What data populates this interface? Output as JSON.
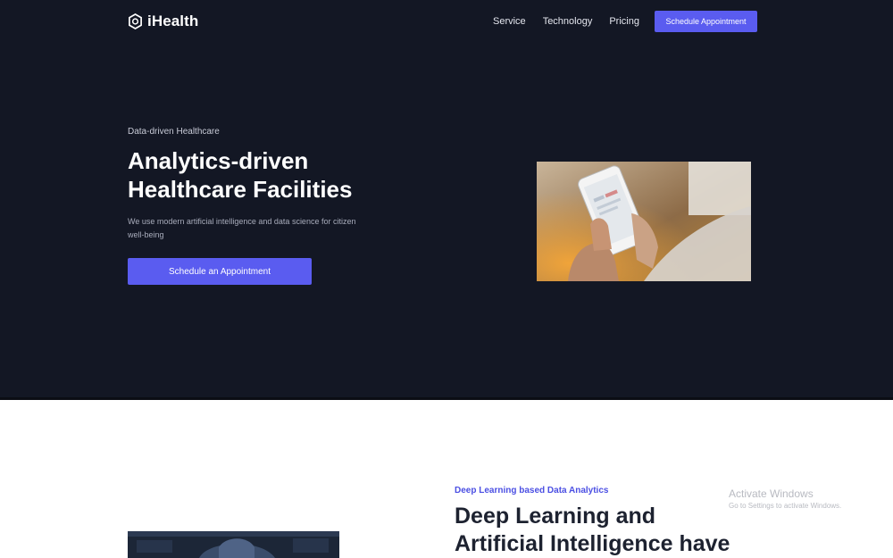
{
  "header": {
    "logo_text": "iHealth",
    "nav": [
      "Service",
      "Technology",
      "Pricing"
    ],
    "cta": "Schedule Appointment"
  },
  "hero": {
    "eyebrow": "Data-driven Healthcare",
    "title": "Analytics-driven Healthcare Facilities",
    "subtitle": "We use modern artificial intelligence and data science for citizen well-being",
    "button": "Schedule an Appointment"
  },
  "section": {
    "eyebrow": "Deep Learning based Data Analytics",
    "title": "Deep Learning and Artificial Intelligence have"
  },
  "overlay": {
    "activate_title": "Activate Windows",
    "activate_sub": "Go to Settings to activate Windows."
  },
  "colors": {
    "hero_bg": "#131724",
    "accent": "#5a5cf0",
    "eyebrow_accent": "#4b4fe3"
  }
}
